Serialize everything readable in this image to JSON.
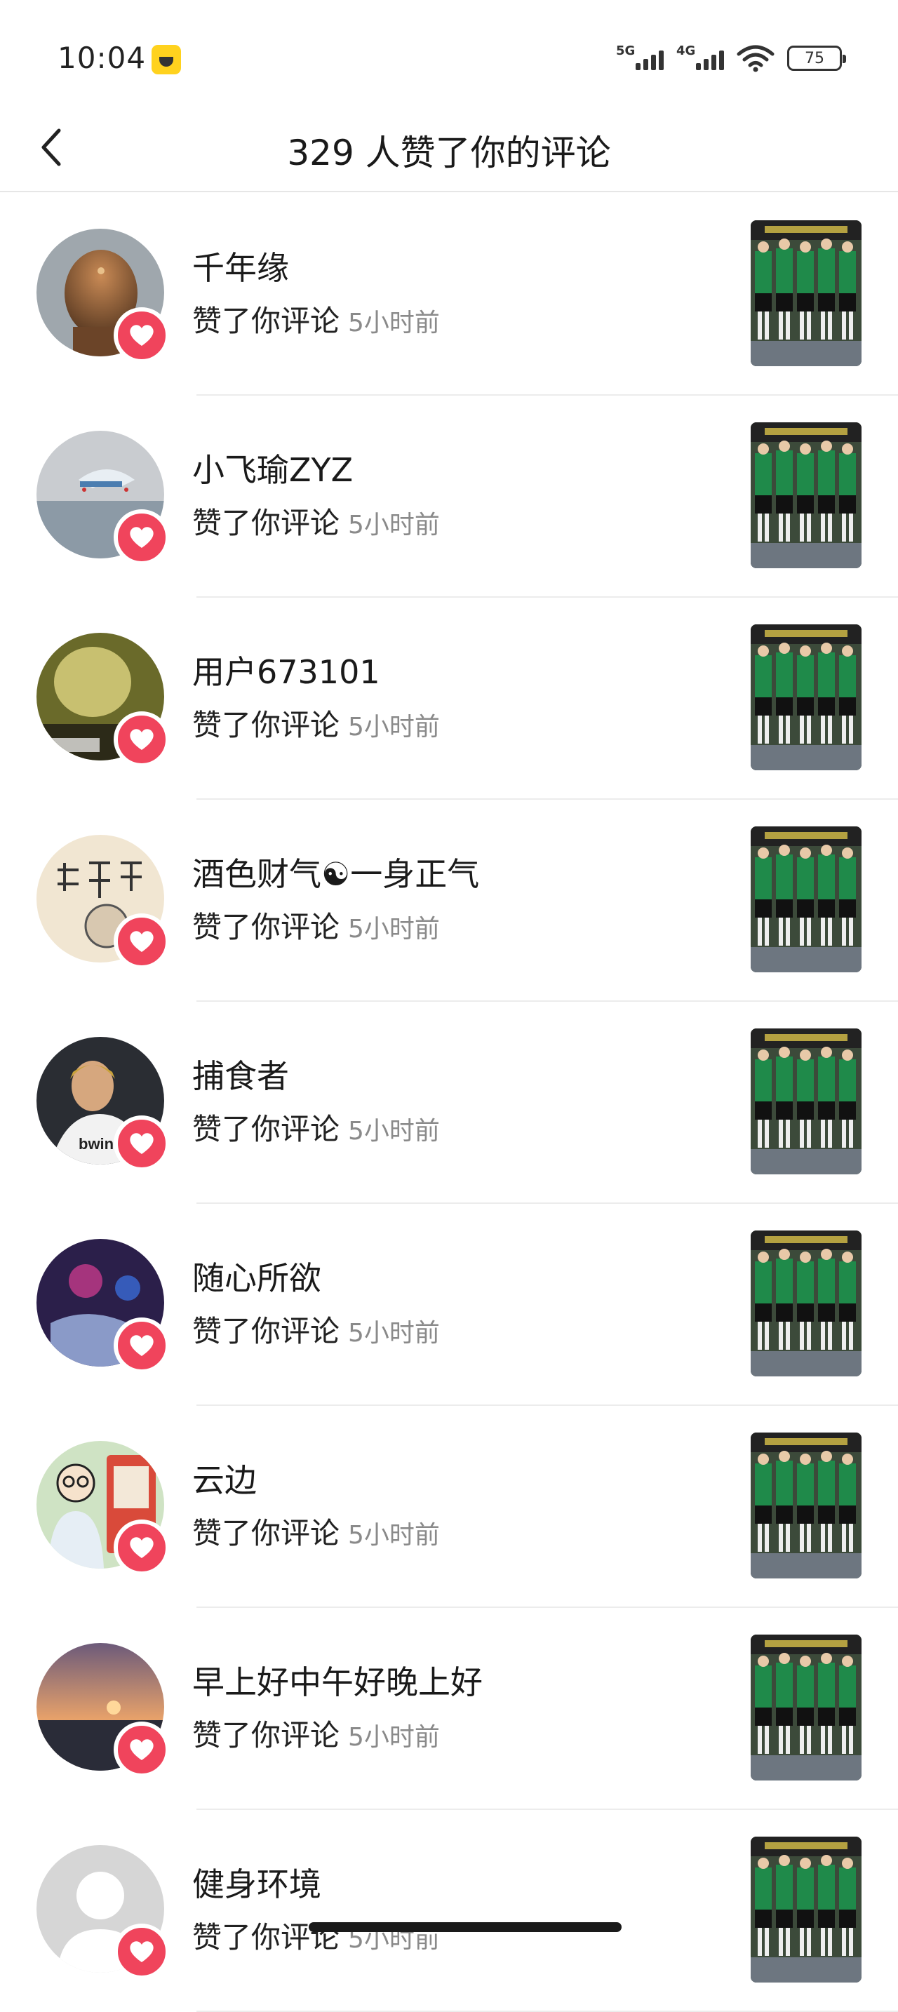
{
  "status_bar": {
    "time": "10:04",
    "network_1": "5G",
    "network_2": "4G",
    "battery": "75",
    "app_icon": "bear-app-icon"
  },
  "header": {
    "title": "329 人赞了你的评论",
    "back_icon": "chevron-left-icon"
  },
  "colors": {
    "like_badge": "#f0445c",
    "separator": "#ececec",
    "secondary_text": "#8a8a8a"
  },
  "notifications": [
    {
      "username": "千年缘",
      "action": "赞了你评论",
      "time": "5小时前"
    },
    {
      "username": "小飞瑜ZYZ",
      "action": "赞了你评论",
      "time": "5小时前"
    },
    {
      "username": "用户673101",
      "action": "赞了你评论",
      "time": "5小时前"
    },
    {
      "username": "酒色财气☯一身正气",
      "action": "赞了你评论",
      "time": "5小时前"
    },
    {
      "username": "捕食者",
      "action": "赞了你评论",
      "time": "5小时前"
    },
    {
      "username": "随心所欲",
      "action": "赞了你评论",
      "time": "5小时前"
    },
    {
      "username": "云边",
      "action": "赞了你评论",
      "time": "5小时前"
    },
    {
      "username": "早上好中午好晚上好",
      "action": "赞了你评论",
      "time": "5小时前"
    },
    {
      "username": "健身环境",
      "action": "赞了你评论",
      "time": "5小时前"
    }
  ]
}
